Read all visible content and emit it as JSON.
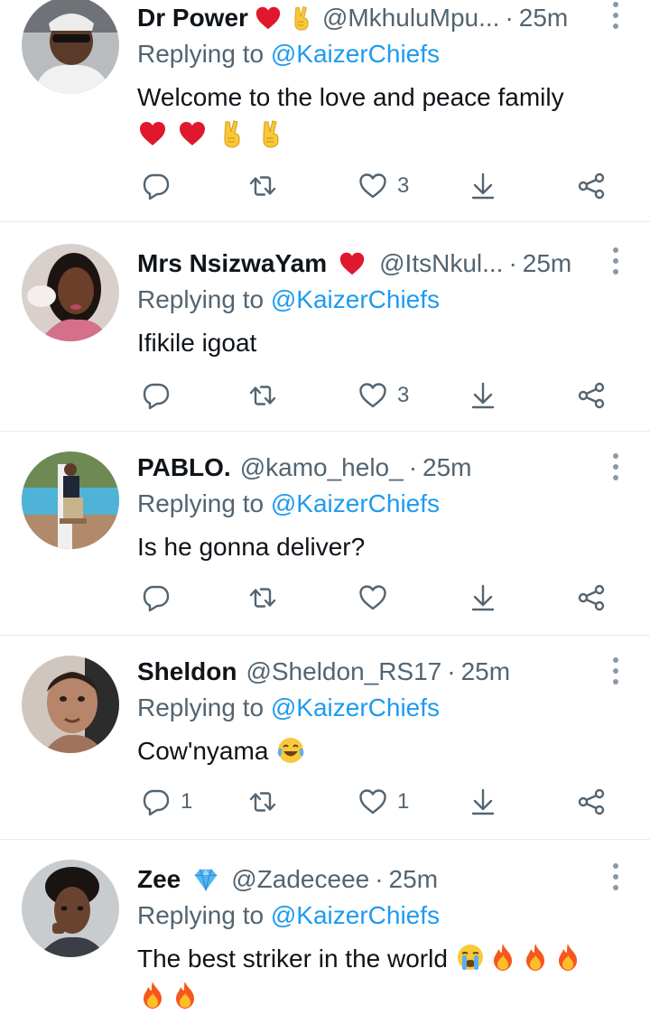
{
  "reply_prefix": "Replying to",
  "tweets": [
    {
      "name": "Dr Power",
      "badges": [
        "red-heart-emoji",
        "victory-hand-emoji"
      ],
      "handle": "@MkhuluMpu...",
      "dot": "·",
      "time": "25m",
      "reply_to": "@KaizerChiefs",
      "text_line1": "Welcome to the love and peace family",
      "text_line2_emojis": [
        "red-heart-emoji",
        "red-heart-emoji",
        "victory-hand-emoji",
        "victory-hand-emoji"
      ],
      "reply_count": "",
      "retweet_count": "",
      "like_count": "3"
    },
    {
      "name": "Mrs NsizwaYam",
      "badges": [
        "red-heart-emoji"
      ],
      "handle": "@ItsNkul...",
      "dot": "·",
      "time": "25m",
      "reply_to": "@KaizerChiefs",
      "text_line1": "Ifikile igoat",
      "reply_count": "",
      "retweet_count": "",
      "like_count": "3"
    },
    {
      "name": "PABLO.",
      "badges": [],
      "handle": "@kamo_helo_",
      "dot": "·",
      "time": "25m",
      "reply_to": "@KaizerChiefs",
      "text_line1": "Is he gonna deliver?",
      "reply_count": "",
      "retweet_count": "",
      "like_count": ""
    },
    {
      "name": "Sheldon",
      "badges": [],
      "handle": "@Sheldon_RS17",
      "dot": "·",
      "time": "25m",
      "reply_to": "@KaizerChiefs",
      "text_line1": "Cow'nyama",
      "text_line1_emojis": [
        "tears-of-joy-emoji"
      ],
      "reply_count": "1",
      "retweet_count": "",
      "like_count": "1"
    },
    {
      "name": "Zee",
      "badges": [
        "gem-stone-emoji"
      ],
      "handle": "@Zadeceee",
      "dot": "·",
      "time": "25m",
      "reply_to": "@KaizerChiefs",
      "text_line1": "The best striker in the world",
      "text_line1_emojis": [
        "loudly-crying-emoji",
        "fire-emoji",
        "fire-emoji",
        "fire-emoji"
      ],
      "text_line2_emojis": [
        "fire-emoji",
        "fire-emoji"
      ],
      "reply_count": "",
      "retweet_count": "",
      "like_count": ""
    }
  ],
  "colors": {
    "handle_gray": "#536471",
    "link_blue": "#1d9bf0",
    "heart_red": "#e0182d",
    "divider": "#e6ecf0"
  }
}
